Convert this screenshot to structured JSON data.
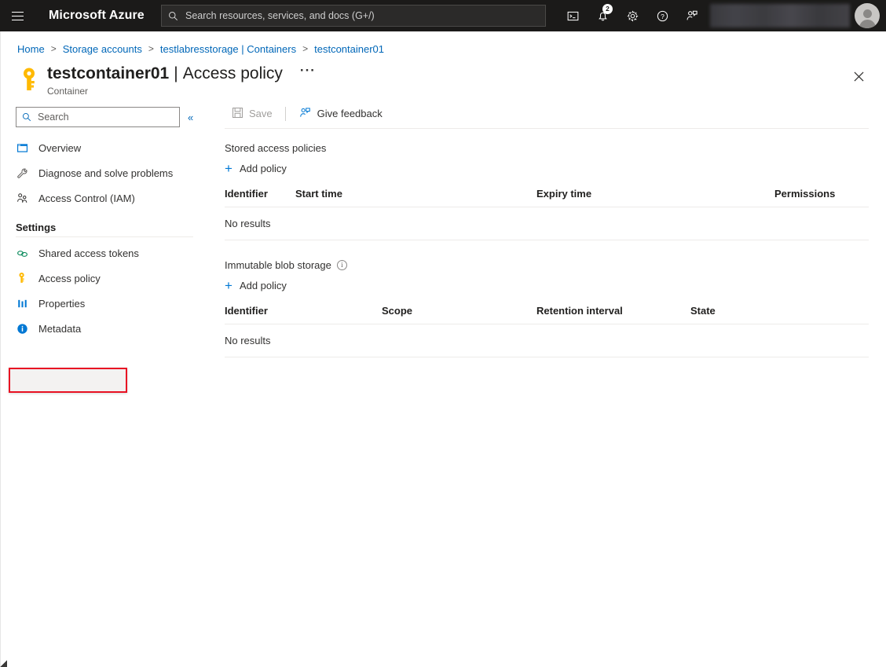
{
  "topbar": {
    "menu_icon": "hamburger-icon",
    "brand": "Microsoft Azure",
    "search_placeholder": "Search resources, services, and docs (G+/)",
    "search_value": "",
    "search_icon": "search-icon",
    "icons": [
      {
        "name": "cloud-shell-icon",
        "label": "Cloud Shell"
      },
      {
        "name": "notifications-icon",
        "label": "Notifications",
        "badge": "2"
      },
      {
        "name": "settings-gear-icon",
        "label": "Settings"
      },
      {
        "name": "help-question-icon",
        "label": "Help"
      },
      {
        "name": "feedback-icon",
        "label": "Feedback"
      }
    ],
    "account_blurred": "",
    "avatar": "user-avatar"
  },
  "breadcrumb": {
    "items": [
      "Home",
      "Storage accounts",
      "testlabresstorage | Containers",
      "testcontainer01"
    ],
    "separator": ">"
  },
  "header": {
    "icon": "key-icon",
    "resource_name": "testcontainer01",
    "divider": "|",
    "page_name": "Access policy",
    "ellipsis": "···",
    "subtitle": "Container",
    "close_icon": "close-icon"
  },
  "sidebar": {
    "search_placeholder": "Search",
    "search_value": "",
    "search_icon": "search-icon",
    "collapse_icon": "«",
    "items": [
      {
        "label": "Overview",
        "icon": "overview-icon",
        "selected": false
      },
      {
        "label": "Diagnose and solve problems",
        "icon": "wrench-icon",
        "selected": false
      },
      {
        "label": "Access Control (IAM)",
        "icon": "people-icon",
        "selected": false
      }
    ],
    "group_label": "Settings",
    "settings_items": [
      {
        "label": "Shared access tokens",
        "icon": "link-chain-icon",
        "selected": false
      },
      {
        "label": "Access policy",
        "icon": "key-icon",
        "selected": true
      },
      {
        "label": "Properties",
        "icon": "properties-bars-icon",
        "selected": false
      },
      {
        "label": "Metadata",
        "icon": "info-filled-icon",
        "selected": false
      }
    ],
    "highlight_color": "#e81123"
  },
  "toolbar": {
    "save_label": "Save",
    "save_icon": "save-disk-icon",
    "save_disabled": true,
    "feedback_label": "Give feedback",
    "feedback_icon": "feedback-person-icon"
  },
  "main": {
    "stored_access_policies": {
      "title": "Stored access policies",
      "add_label": "Add policy",
      "add_icon": "plus-icon",
      "columns": [
        "Identifier",
        "Start time",
        "Expiry time",
        "Permissions"
      ],
      "rows": [],
      "empty_text": "No results"
    },
    "immutable_blob_storage": {
      "title": "Immutable blob storage",
      "info_icon": "info-outline-icon",
      "add_label": "Add policy",
      "add_icon": "plus-icon",
      "columns": [
        "Identifier",
        "Scope",
        "Retention interval",
        "State"
      ],
      "rows": [],
      "empty_text": "No results"
    }
  },
  "colors": {
    "accent": "#0078d4",
    "link": "#0067b8",
    "topbar_bg": "#1b1a19",
    "selected_bg": "#edebe9",
    "highlight_red": "#e81123",
    "key_gold": "#ffb900"
  }
}
